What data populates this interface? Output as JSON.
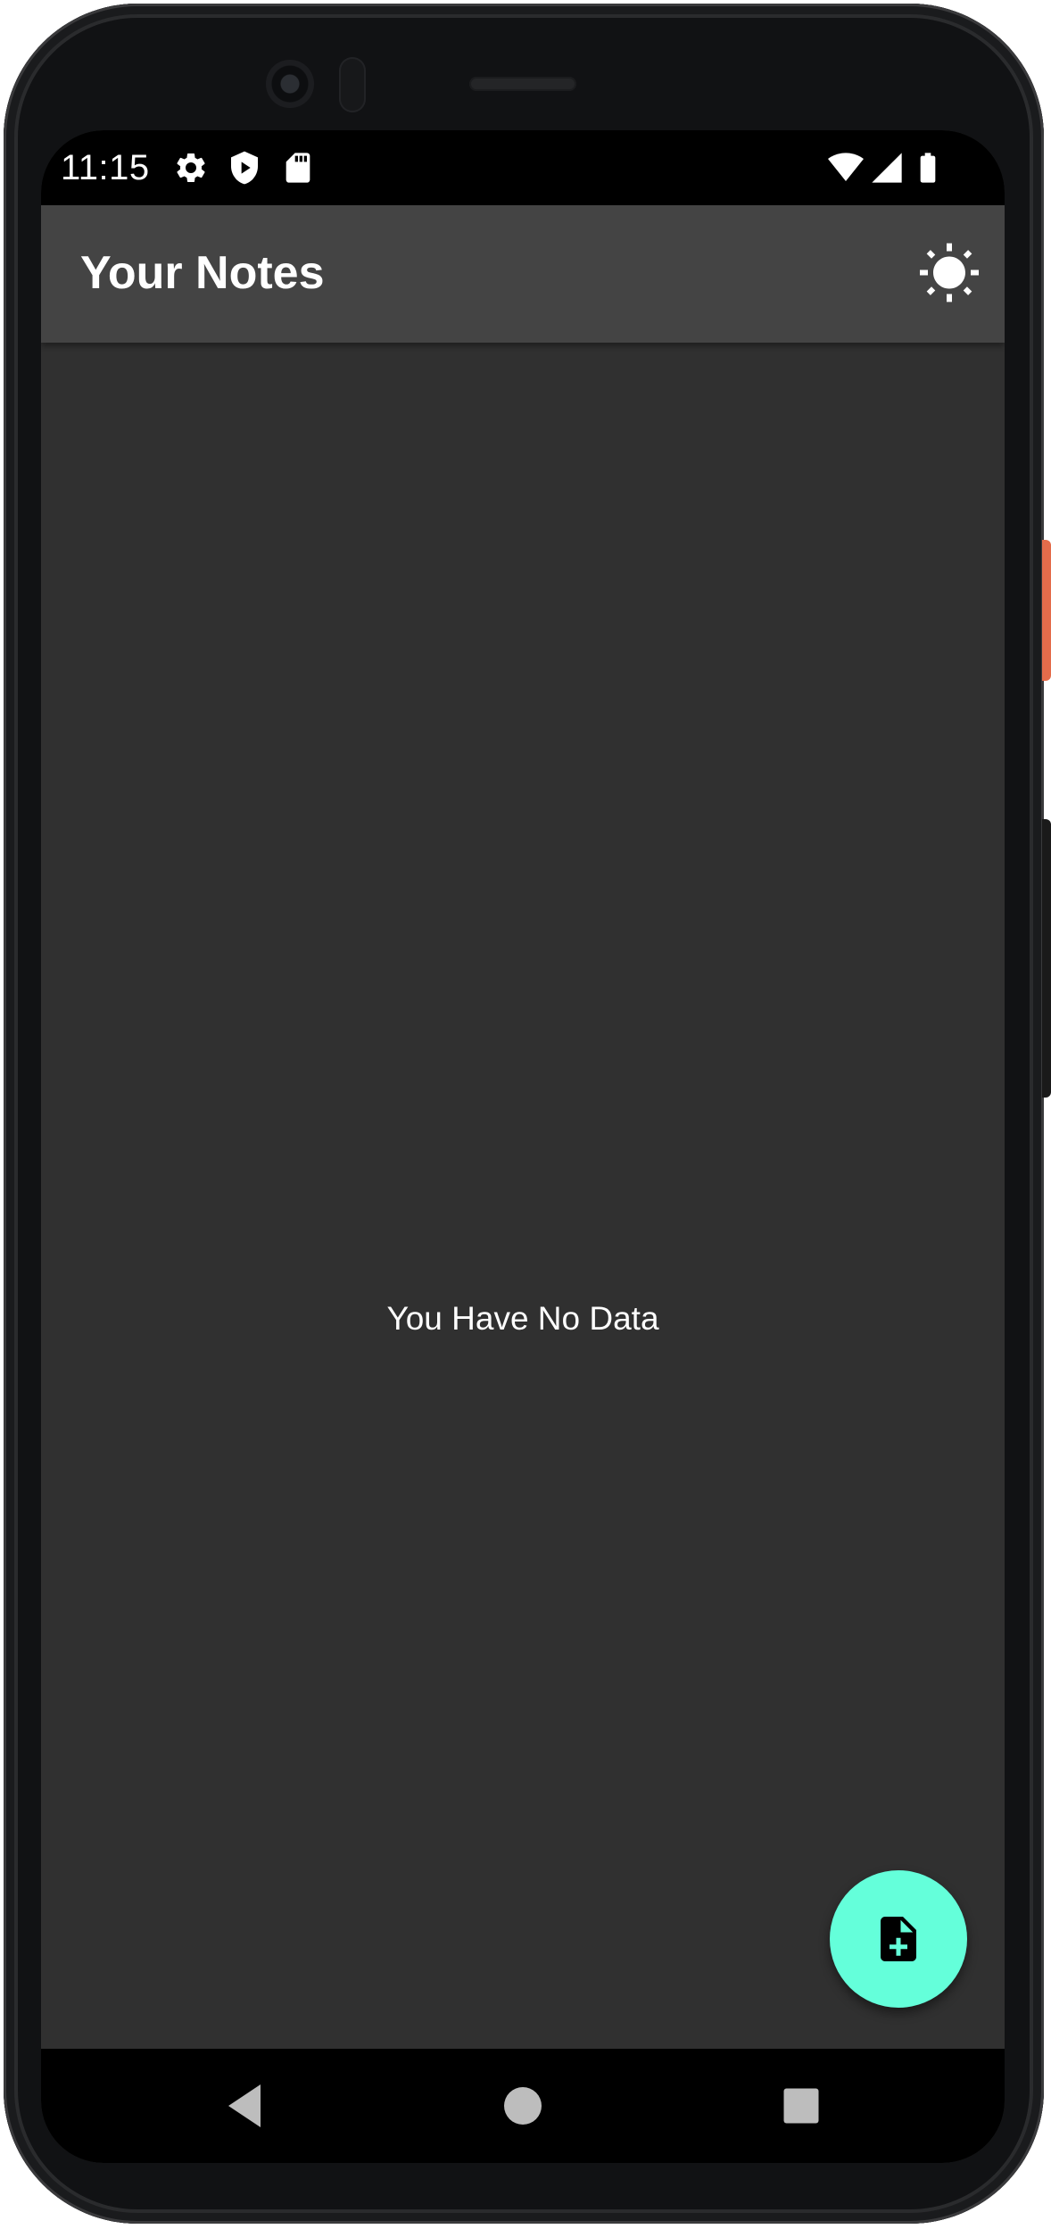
{
  "status_bar": {
    "time": "11:15",
    "left_icons": [
      "settings-icon",
      "shield-play-icon",
      "sd-card-icon"
    ],
    "right_icons": [
      "wifi-icon",
      "signal-icon",
      "battery-icon"
    ]
  },
  "app_bar": {
    "title": "Your Notes",
    "action_icon": "brightness-icon"
  },
  "main": {
    "empty_message": "You Have No Data"
  },
  "fab": {
    "icon": "note-add-icon",
    "color": "#64ffda"
  },
  "nav_bar": {
    "buttons": [
      "back-icon",
      "home-icon",
      "recents-icon"
    ]
  },
  "colors": {
    "background": "#303030",
    "app_bar": "#444444",
    "status_bar": "#000000",
    "accent": "#64ffda"
  }
}
